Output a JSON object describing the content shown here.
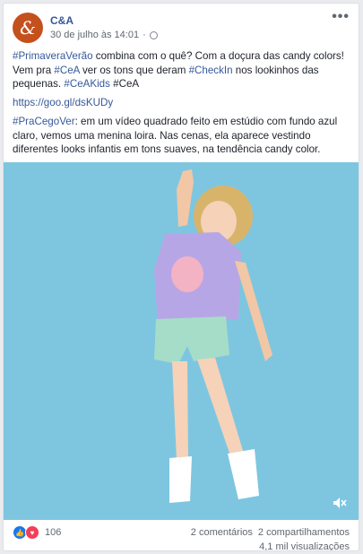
{
  "post": {
    "page_name": "C&A",
    "avatar_text": "&",
    "timestamp": "30 de julho às 14:01",
    "privacy_icon": "globe-icon",
    "more_label": "•••"
  },
  "content": {
    "p1": {
      "tag1": "#PrimaveraVerão",
      "t1": " combina com o quê? Com a doçura das candy colors! Vem pra ",
      "tag2": "#CeA",
      "t2": " ver os tons que deram ",
      "tag3": "#CheckIn",
      "t3": " nos lookinhos das pequenas. ",
      "tag4": "#CeAKids",
      "t4": " #CeA"
    },
    "link": "https://goo.gl/dsKUDy",
    "p3": {
      "tag": "#PraCegoVer",
      "text": ": em um vídeo quadrado feito em estúdio com fundo azul claro, vemos uma menina loira. Nas cenas, ela aparece vestindo diferentes looks infantis em tons suaves, na tendência candy color."
    }
  },
  "video": {
    "mute_icon": "speaker-muted-icon"
  },
  "footer": {
    "reaction_count": "106",
    "comments": "2 comentários",
    "shares": "2 compartilhamentos",
    "views": "4,1 mil visualizações"
  },
  "colors": {
    "brand": "#c4501e",
    "link": "#365899",
    "video_bg": "#7ec6e0"
  }
}
